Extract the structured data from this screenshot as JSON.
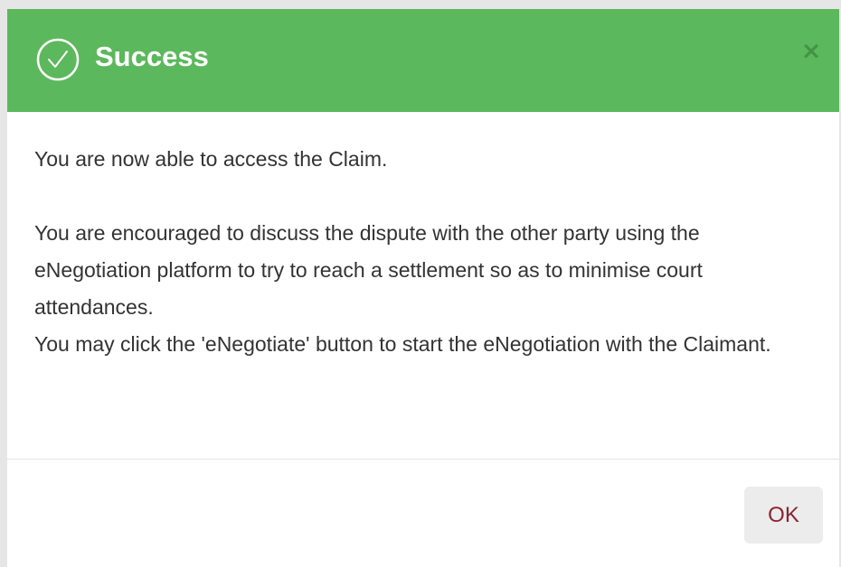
{
  "dialog": {
    "title": "Success",
    "close_label": "×",
    "message_access": "You are now able to access the Claim.",
    "message_encourage": "You are encouraged to discuss the dispute with the other party using the eNegotiation platform to try to reach a settlement so as to minimise court attendances.",
    "message_click": "You may click the 'eNegotiate' button to start the eNegotiation with the Claimant.",
    "ok_label": "OK"
  },
  "colors": {
    "header": "#5cb85c",
    "ok_text": "#8b2330",
    "ok_background": "#ececec"
  },
  "icons": {
    "header": "check-circle-icon",
    "close": "close-icon"
  }
}
